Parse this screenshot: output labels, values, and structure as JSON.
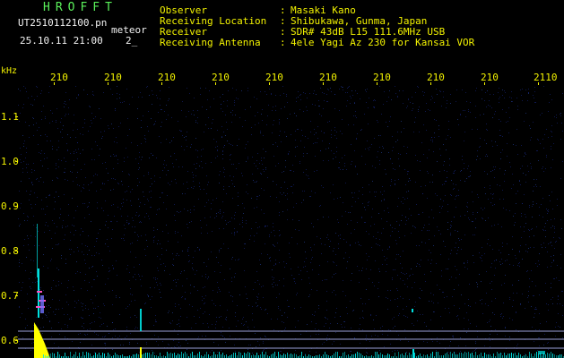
{
  "header": {
    "app_title": "HROFFT",
    "file_name": "UT2510112100.pn",
    "detector_label": "meteor",
    "date_time": "25.10.11 21:00",
    "count": "2_"
  },
  "station_info": [
    {
      "label": "Observer",
      "sep": ":",
      "value": "Masaki Kano"
    },
    {
      "label": "Receiving Location",
      "sep": ":",
      "value": "Shibukawa, Gunma, Japan"
    },
    {
      "label": "Receiver",
      "sep": ":",
      "value": "SDR# 43dB L15 111.6MHz USB"
    },
    {
      "label": "Receiving Antenna",
      "sep": ":",
      "value": "4ele Yagi Az 230 for Kansai VOR"
    }
  ],
  "axis": {
    "y_unit": "kHz",
    "time_ticks": [
      "210",
      "210",
      "210",
      "210",
      "210",
      "210",
      "210",
      "210",
      "210",
      "2110"
    ],
    "freq_ticks": [
      "1.1",
      "1.0",
      "0.9",
      "0.8",
      "0.7",
      "0.6"
    ]
  },
  "colors": {
    "background": "#000000",
    "title": "#5af05a",
    "text": "#f2f2f2",
    "axis_labels": "#f2f200",
    "reference_lines": "#9aa0d8",
    "noise": "#1a2a8a",
    "signal_hot": "#ffff00",
    "signal_mid": "#00e0e0",
    "signal_pink": "#ff50c0"
  }
}
